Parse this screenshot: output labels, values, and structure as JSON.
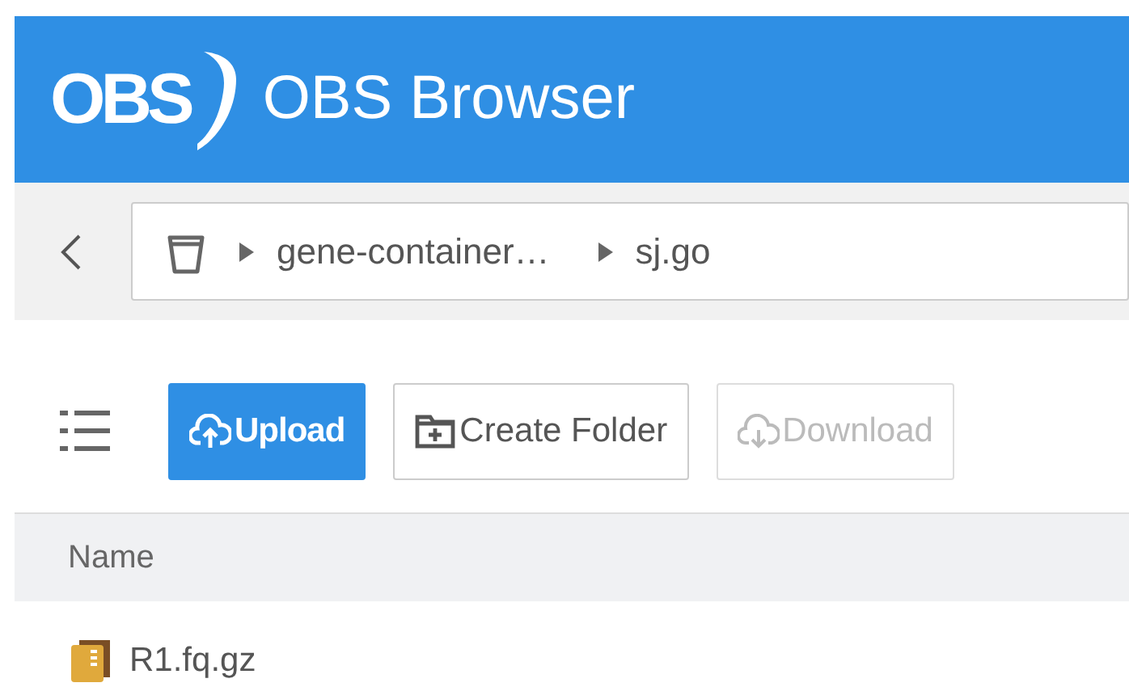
{
  "header": {
    "logo_text": "OBS",
    "title": "OBS Browser"
  },
  "breadcrumb": {
    "segments": [
      {
        "kind": "bucket",
        "label": "gene-container…"
      },
      {
        "kind": "folder",
        "label": "sj.go"
      }
    ]
  },
  "toolbar": {
    "buttons": [
      {
        "kind": "upload",
        "label": "Upload",
        "primary": true,
        "disabled": false
      },
      {
        "kind": "create-folder",
        "label": "Create Folder",
        "primary": false,
        "disabled": false
      },
      {
        "kind": "download",
        "label": "Download",
        "primary": false,
        "disabled": true
      }
    ]
  },
  "table": {
    "columns": [
      "Name"
    ],
    "rows": [
      {
        "kind": "archive",
        "name": "R1.fq.gz"
      }
    ]
  }
}
